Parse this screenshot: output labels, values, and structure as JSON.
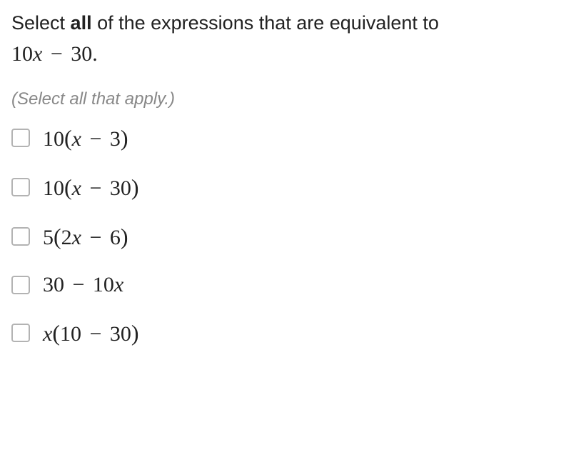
{
  "prompt": {
    "pre": "Select ",
    "bold": "all",
    "post": " of the expressions that are equivalent to ",
    "expr_coef": "10",
    "expr_var": "x",
    "expr_minus": " − ",
    "expr_const": "30",
    "period": "."
  },
  "hint": "(Select all that apply.)",
  "options": [
    {
      "id": "opt-10x-minus-3",
      "lead_coef": "10",
      "lead_var": "",
      "open": "(",
      "a": "",
      "ax": "x",
      "minus": " − ",
      "b": "3",
      "close": ")"
    },
    {
      "id": "opt-10x-minus-30",
      "lead_coef": "10",
      "lead_var": "",
      "open": "(",
      "a": "",
      "ax": "x",
      "minus": " − ",
      "b": "30",
      "close": ")"
    },
    {
      "id": "opt-5-2x-minus-6",
      "lead_coef": "5",
      "lead_var": "",
      "open": "(",
      "a": "2",
      "ax": "x",
      "minus": " − ",
      "b": "6",
      "close": ")"
    },
    {
      "id": "opt-30-minus-10x",
      "lead_coef": "",
      "lead_var": "",
      "open": "",
      "a": "30",
      "ax": "",
      "minus": " − ",
      "b_coef": "10",
      "bx": "x",
      "b": "",
      "close": ""
    },
    {
      "id": "opt-x-10-minus-30",
      "lead_coef": "",
      "lead_var": "x",
      "open": "(",
      "a": "10",
      "ax": "",
      "minus": " − ",
      "b": "30",
      "close": ")"
    }
  ]
}
